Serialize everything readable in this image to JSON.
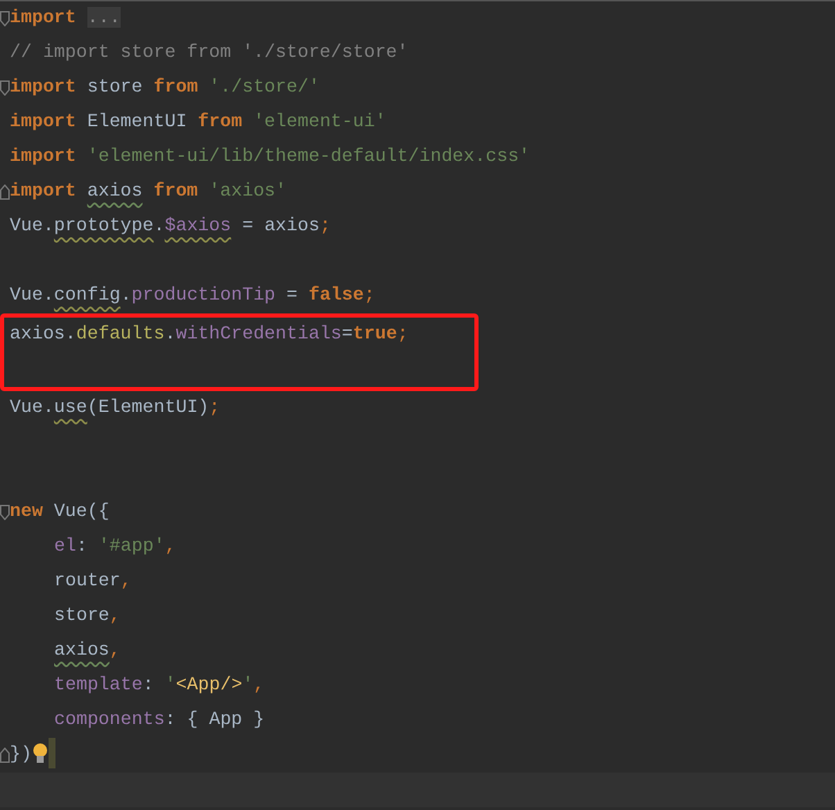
{
  "code_lines": [
    {
      "fold_start": true,
      "tokens": [
        {
          "text": "import ",
          "kind": "keyword"
        },
        {
          "text": "...",
          "kind": "folded"
        }
      ]
    },
    {
      "tokens": [
        {
          "text": "// import store from './store/store'",
          "kind": "comment"
        }
      ]
    },
    {
      "fold_start": true,
      "tokens": [
        {
          "text": "import",
          "kind": "keyword"
        },
        {
          "text": " store ",
          "kind": "plain"
        },
        {
          "text": "from ",
          "kind": "keyword"
        },
        {
          "text": "'./store/'",
          "kind": "string"
        }
      ]
    },
    {
      "tokens": [
        {
          "text": "import",
          "kind": "keyword"
        },
        {
          "text": " ElementUI ",
          "kind": "plain"
        },
        {
          "text": "from ",
          "kind": "keyword"
        },
        {
          "text": "'element-ui'",
          "kind": "string"
        }
      ]
    },
    {
      "tokens": [
        {
          "text": "import ",
          "kind": "keyword"
        },
        {
          "text": "'element-ui/lib/theme-default/index.css'",
          "kind": "string"
        }
      ]
    },
    {
      "fold_end": true,
      "tokens": [
        {
          "text": "import ",
          "kind": "keyword"
        },
        {
          "text": "axios",
          "kind": "plain",
          "typo": true
        },
        {
          "text": " from ",
          "kind": "keyword"
        },
        {
          "text": "'axios'",
          "kind": "string"
        }
      ]
    },
    {
      "tokens": [
        {
          "text": "Vue.",
          "kind": "plain"
        },
        {
          "text": "prototype",
          "kind": "plain",
          "warning": true
        },
        {
          "text": ".",
          "kind": "plain"
        },
        {
          "text": "$axios",
          "kind": "property",
          "warning": true
        },
        {
          "text": " = axios",
          "kind": "plain"
        },
        {
          "text": ";",
          "kind": "punct"
        }
      ]
    },
    {
      "blank": true
    },
    {
      "tokens": [
        {
          "text": "Vue.",
          "kind": "plain"
        },
        {
          "text": "config",
          "kind": "plain",
          "warning": true
        },
        {
          "text": ".",
          "kind": "plain"
        },
        {
          "text": "productionTip",
          "kind": "property"
        },
        {
          "text": " = ",
          "kind": "plain"
        },
        {
          "text": "false",
          "kind": "keyword"
        },
        {
          "text": ";",
          "kind": "punct"
        }
      ]
    },
    {
      "in_box": true,
      "tokens": [
        {
          "text": "axios.",
          "kind": "plain"
        },
        {
          "text": "defaults",
          "kind": "member"
        },
        {
          "text": ".",
          "kind": "plain"
        },
        {
          "text": "withCredentials",
          "kind": "property"
        },
        {
          "text": "=",
          "kind": "plain"
        },
        {
          "text": "true",
          "kind": "keyword"
        },
        {
          "text": ";",
          "kind": "punct"
        }
      ]
    },
    {
      "in_box": true,
      "blank": true
    },
    {
      "tokens": [
        {
          "text": "Vue.",
          "kind": "plain"
        },
        {
          "text": "use",
          "kind": "plain",
          "warning": true
        },
        {
          "text": "(ElementUI)",
          "kind": "plain"
        },
        {
          "text": ";",
          "kind": "punct"
        }
      ]
    },
    {
      "blank": true
    },
    {
      "blank": true
    },
    {
      "fold_start": true,
      "tokens": [
        {
          "text": "new",
          "kind": "keyword"
        },
        {
          "text": " Vue({",
          "kind": "plain"
        }
      ]
    },
    {
      "indent": true,
      "tokens": [
        {
          "text": "el",
          "kind": "property"
        },
        {
          "text": ": ",
          "kind": "plain"
        },
        {
          "text": "'#app'",
          "kind": "string"
        },
        {
          "text": ",",
          "kind": "punct"
        }
      ]
    },
    {
      "indent": true,
      "tokens": [
        {
          "text": "router",
          "kind": "plain"
        },
        {
          "text": ",",
          "kind": "punct"
        }
      ]
    },
    {
      "indent": true,
      "tokens": [
        {
          "text": "store",
          "kind": "plain"
        },
        {
          "text": ",",
          "kind": "punct"
        }
      ]
    },
    {
      "indent": true,
      "tokens": [
        {
          "text": "axios",
          "kind": "plain",
          "typo": true
        },
        {
          "text": ",",
          "kind": "punct"
        }
      ]
    },
    {
      "indent": true,
      "tokens": [
        {
          "text": "template",
          "kind": "property"
        },
        {
          "text": ": ",
          "kind": "plain"
        },
        {
          "text": "'",
          "kind": "string"
        },
        {
          "text": "<App/>",
          "kind": "tag"
        },
        {
          "text": "'",
          "kind": "string"
        },
        {
          "text": ",",
          "kind": "punct"
        }
      ]
    },
    {
      "indent": true,
      "tokens": [
        {
          "text": "components",
          "kind": "property"
        },
        {
          "text": ": { App }",
          "kind": "plain"
        }
      ]
    },
    {
      "fold_end": true,
      "bulb": true,
      "tokens": [
        {
          "text": "})",
          "kind": "plain"
        }
      ]
    },
    {
      "current": true
    }
  ]
}
